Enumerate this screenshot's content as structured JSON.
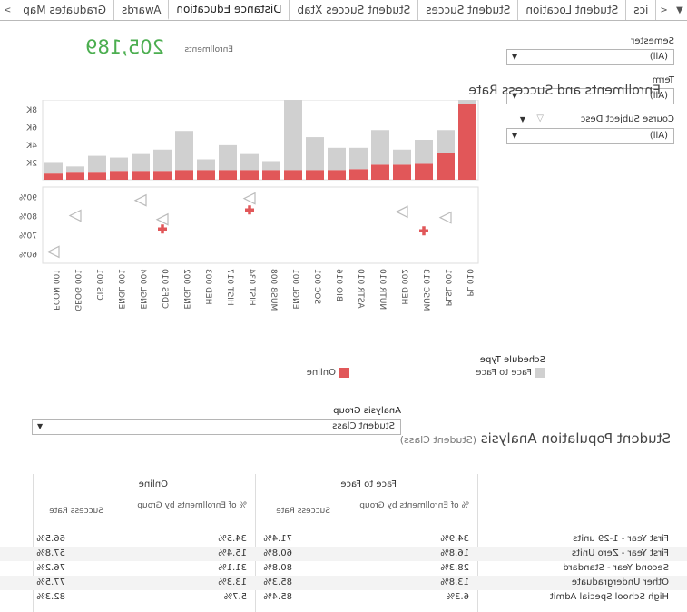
{
  "tabs": {
    "items": [
      "Graduates Map",
      "Awards",
      "Distance Education",
      "Student Succes Xtab",
      "Student Succes",
      "Student Location",
      "ics"
    ],
    "active": "Distance Education"
  },
  "kpi": {
    "label": "Enrollments",
    "value": "205,189"
  },
  "filters": [
    {
      "label": "Semester",
      "value": "(All)"
    },
    {
      "label": "Term",
      "value": "(All)"
    },
    {
      "label": "Course Subject Desc",
      "value": "(All)"
    }
  ],
  "chart_data": {
    "type": "bar",
    "title": "Enrollments and Success Rate",
    "categories": [
      "PL 010",
      "PLSL 001",
      "MUSC 013",
      "HED 002",
      "NUTR 010",
      "ASTR 010",
      "BIO 016",
      "SOC 001",
      "ENGL 001",
      "MUSB 008",
      "HIST 034",
      "HIST 017",
      "HED 003",
      "ENGL 002",
      "CDFS 010",
      "ENGL 004",
      "ENGL 001",
      "CIS 001",
      "GEOG 001",
      "ECON 001"
    ],
    "panels": [
      {
        "name": "Enrollments",
        "ylabel": "Enrollments",
        "ticks": [
          "8K",
          "6K",
          "4K",
          "2K"
        ],
        "ylim": [
          0,
          9000
        ],
        "series": [
          {
            "name": "Face to Face",
            "values": [
              1700,
              2600,
              2700,
              1700,
              3900,
              2400,
              2500,
              3700,
              8500,
              1000,
              1800,
              2800,
              1200,
              4400,
              2400,
              1900,
              1500,
              1800,
              600,
              1300
            ]
          },
          {
            "name": "Online",
            "values": [
              8500,
              3000,
              1800,
              1700,
              1700,
              1200,
              1100,
              1100,
              1100,
              1100,
              1100,
              1100,
              1100,
              1100,
              1000,
              1000,
              1000,
              900,
              900,
              700
            ]
          }
        ]
      },
      {
        "name": "Success Rate",
        "ylabel": "Success Rate",
        "ticks": [
          "90%",
          "80%",
          "70%",
          "60%"
        ],
        "ylim": [
          55,
          95
        ],
        "series": [
          {
            "name": "Face to Face",
            "values": [
              null,
              79,
              null,
              82,
              null,
              null,
              null,
              null,
              null,
              null,
              89,
              null,
              null,
              null,
              78,
              88,
              null,
              null,
              80,
              61
            ]
          },
          {
            "name": "Online",
            "values": [
              null,
              null,
              72,
              null,
              null,
              null,
              null,
              null,
              null,
              null,
              83,
              null,
              null,
              null,
              73,
              null,
              null,
              null,
              null,
              null
            ]
          }
        ]
      }
    ],
    "legend": {
      "title": "Schedule Type",
      "items": [
        {
          "name": "Face to Face",
          "color": "#d0d0d0"
        },
        {
          "name": "Online",
          "color": "#e15759"
        }
      ]
    }
  },
  "analysis_group": {
    "label": "Analysis Group",
    "value": "Student Class"
  },
  "population": {
    "title": "Student Population Analysis",
    "subtitle": "(Student Class)"
  },
  "table": {
    "groups": [
      "Face to Face",
      "Online"
    ],
    "subheaders": [
      "% of Enrollments by Group",
      "Success Rate",
      "% of Enrollments by Group",
      "Success Rate"
    ],
    "rows": [
      {
        "label": "First Year - 1-29 units",
        "cells": [
          "34.9%",
          "71.4%",
          "34.5%",
          "66.5%"
        ]
      },
      {
        "label": "First Year - Zero Units",
        "cells": [
          "16.8%",
          "60.8%",
          "15.4%",
          "57.8%"
        ]
      },
      {
        "label": "Second Year - Standard",
        "cells": [
          "28.3%",
          "80.8%",
          "31.1%",
          "76.2%"
        ]
      },
      {
        "label": "Other Undergraduate",
        "cells": [
          "13.8%",
          "85.3%",
          "13.3%",
          "77.5%"
        ]
      },
      {
        "label": "High School Special Admit",
        "cells": [
          "6.3%",
          "85.4%",
          "5.7%",
          "82.3%"
        ]
      }
    ]
  }
}
